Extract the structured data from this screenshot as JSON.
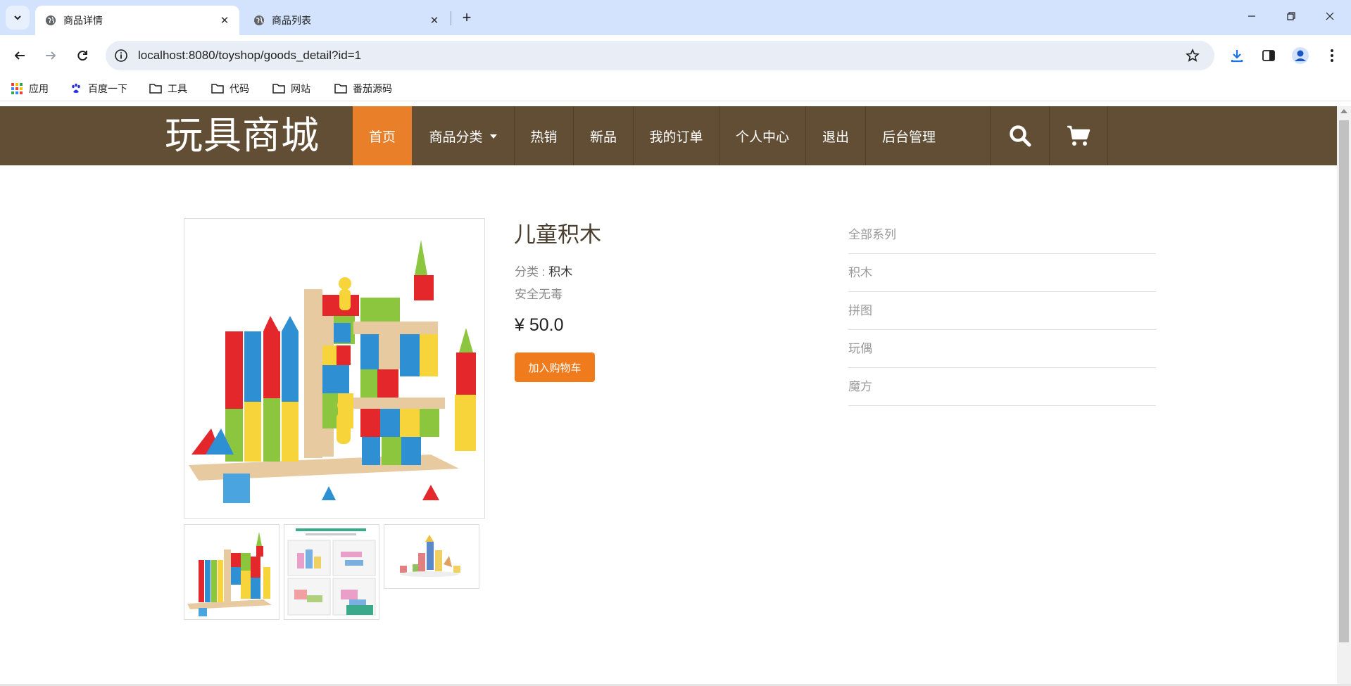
{
  "browser": {
    "tabs": [
      {
        "title": "商品详情",
        "active": true
      },
      {
        "title": "商品列表",
        "active": false
      }
    ],
    "url": "localhost:8080/toyshop/goods_detail?id=1",
    "bookmarks": [
      {
        "label": "应用",
        "icon": "apps-grid-icon"
      },
      {
        "label": "百度一下",
        "icon": "baidu-paw-icon"
      },
      {
        "label": "工具",
        "icon": "folder-icon"
      },
      {
        "label": "代码",
        "icon": "folder-icon"
      },
      {
        "label": "网站",
        "icon": "folder-icon"
      },
      {
        "label": "番茄源码",
        "icon": "folder-icon"
      }
    ]
  },
  "site": {
    "brand": "玩具商城",
    "nav": [
      {
        "label": "首页",
        "active": true
      },
      {
        "label": "商品分类",
        "dropdown": true
      },
      {
        "label": "热销"
      },
      {
        "label": "新品"
      },
      {
        "label": "我的订单"
      },
      {
        "label": "个人中心"
      },
      {
        "label": "退出"
      },
      {
        "label": "后台管理"
      }
    ],
    "icons": [
      "search-icon",
      "cart-icon"
    ],
    "colors": {
      "navbar": "#614e35",
      "accent": "#e97f28",
      "button": "#f07b1c"
    }
  },
  "product": {
    "name": "儿童积木",
    "category_label": "分类 : ",
    "category": "积木",
    "description": "安全无毒",
    "price": "¥ 50.0",
    "add_to_cart": "加入购物车",
    "thumbnails": 3
  },
  "series": {
    "items": [
      "全部系列",
      "积木",
      "拼图",
      "玩偶",
      "魔方"
    ]
  }
}
